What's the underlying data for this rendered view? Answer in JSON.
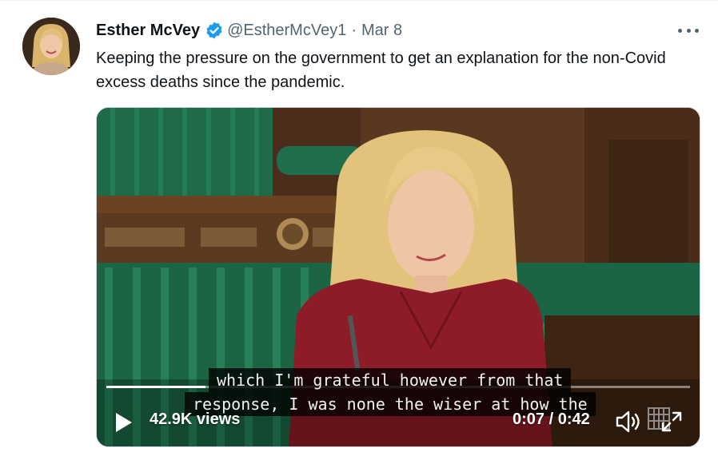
{
  "author": {
    "name": "Esther McVey",
    "handle": "@EstherMcVey1",
    "separator": "·",
    "date": "Mar 8",
    "verified": true,
    "avatar_icon": "profile-photo"
  },
  "tweet": {
    "text": "Keeping the pressure on the government to get an explanation for the non-Covid excess deaths since the pandemic."
  },
  "video": {
    "subtitle_line_1": "which I'm grateful however from that",
    "subtitle_line_2": "response, I was none the wiser at how the",
    "views": "42.9K views",
    "time": "0:07 / 0:42",
    "progress_fraction": 0.17,
    "icons": [
      "play-icon",
      "volume-icon",
      "expand-icon",
      "portcullis-logo"
    ]
  },
  "colors": {
    "verified_badge": "#1d9bf0",
    "text_secondary": "#536471",
    "bench_green": "#1f7a55",
    "dress_red": "#8e1c28"
  }
}
